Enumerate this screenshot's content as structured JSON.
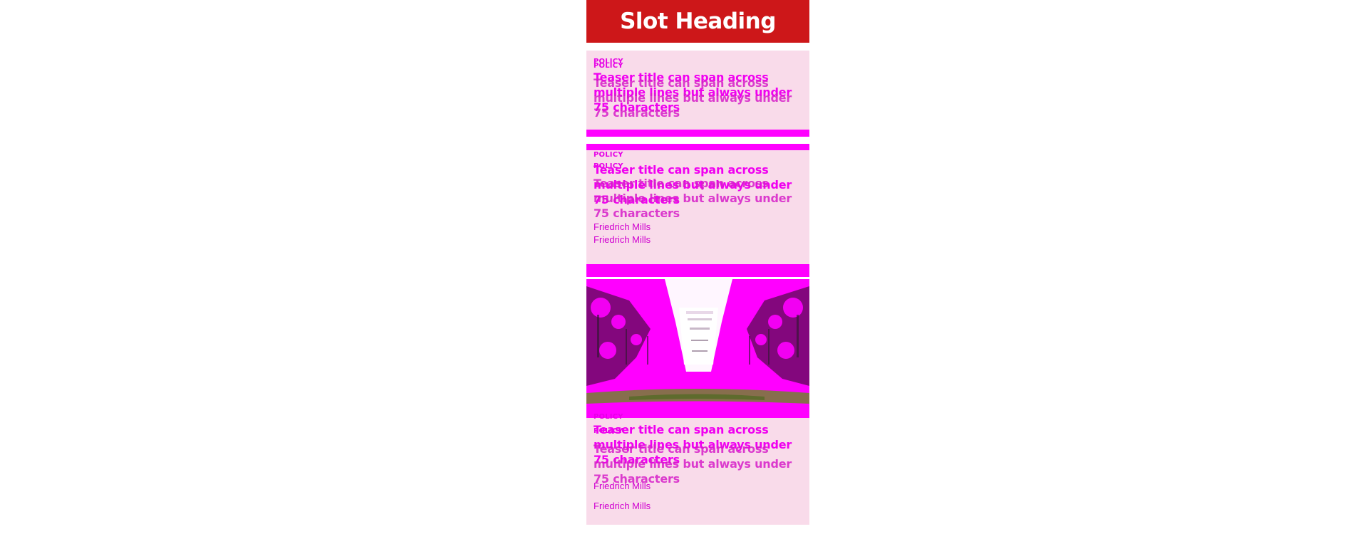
{
  "slot": {
    "heading": "Slot Heading",
    "colors": {
      "heading_bg": "#cd1719",
      "card_bg": "#f9dbea",
      "accent": "#ff00ff"
    },
    "teasers": [
      {
        "kicker": "POLICY",
        "title": "Teaser title can span across multiple lines but always under 75 characters"
      },
      {
        "kicker": "POLICY",
        "title": "Teaser title can span across multiple lines but always under 75 characters",
        "author": "Friedrich Mills"
      },
      {
        "kicker": "POLICY",
        "title": "Teaser title can span across multiple lines but always under 75 characters",
        "author": "Friedrich Mills",
        "image": "tree-lined-avenue-image"
      }
    ]
  }
}
